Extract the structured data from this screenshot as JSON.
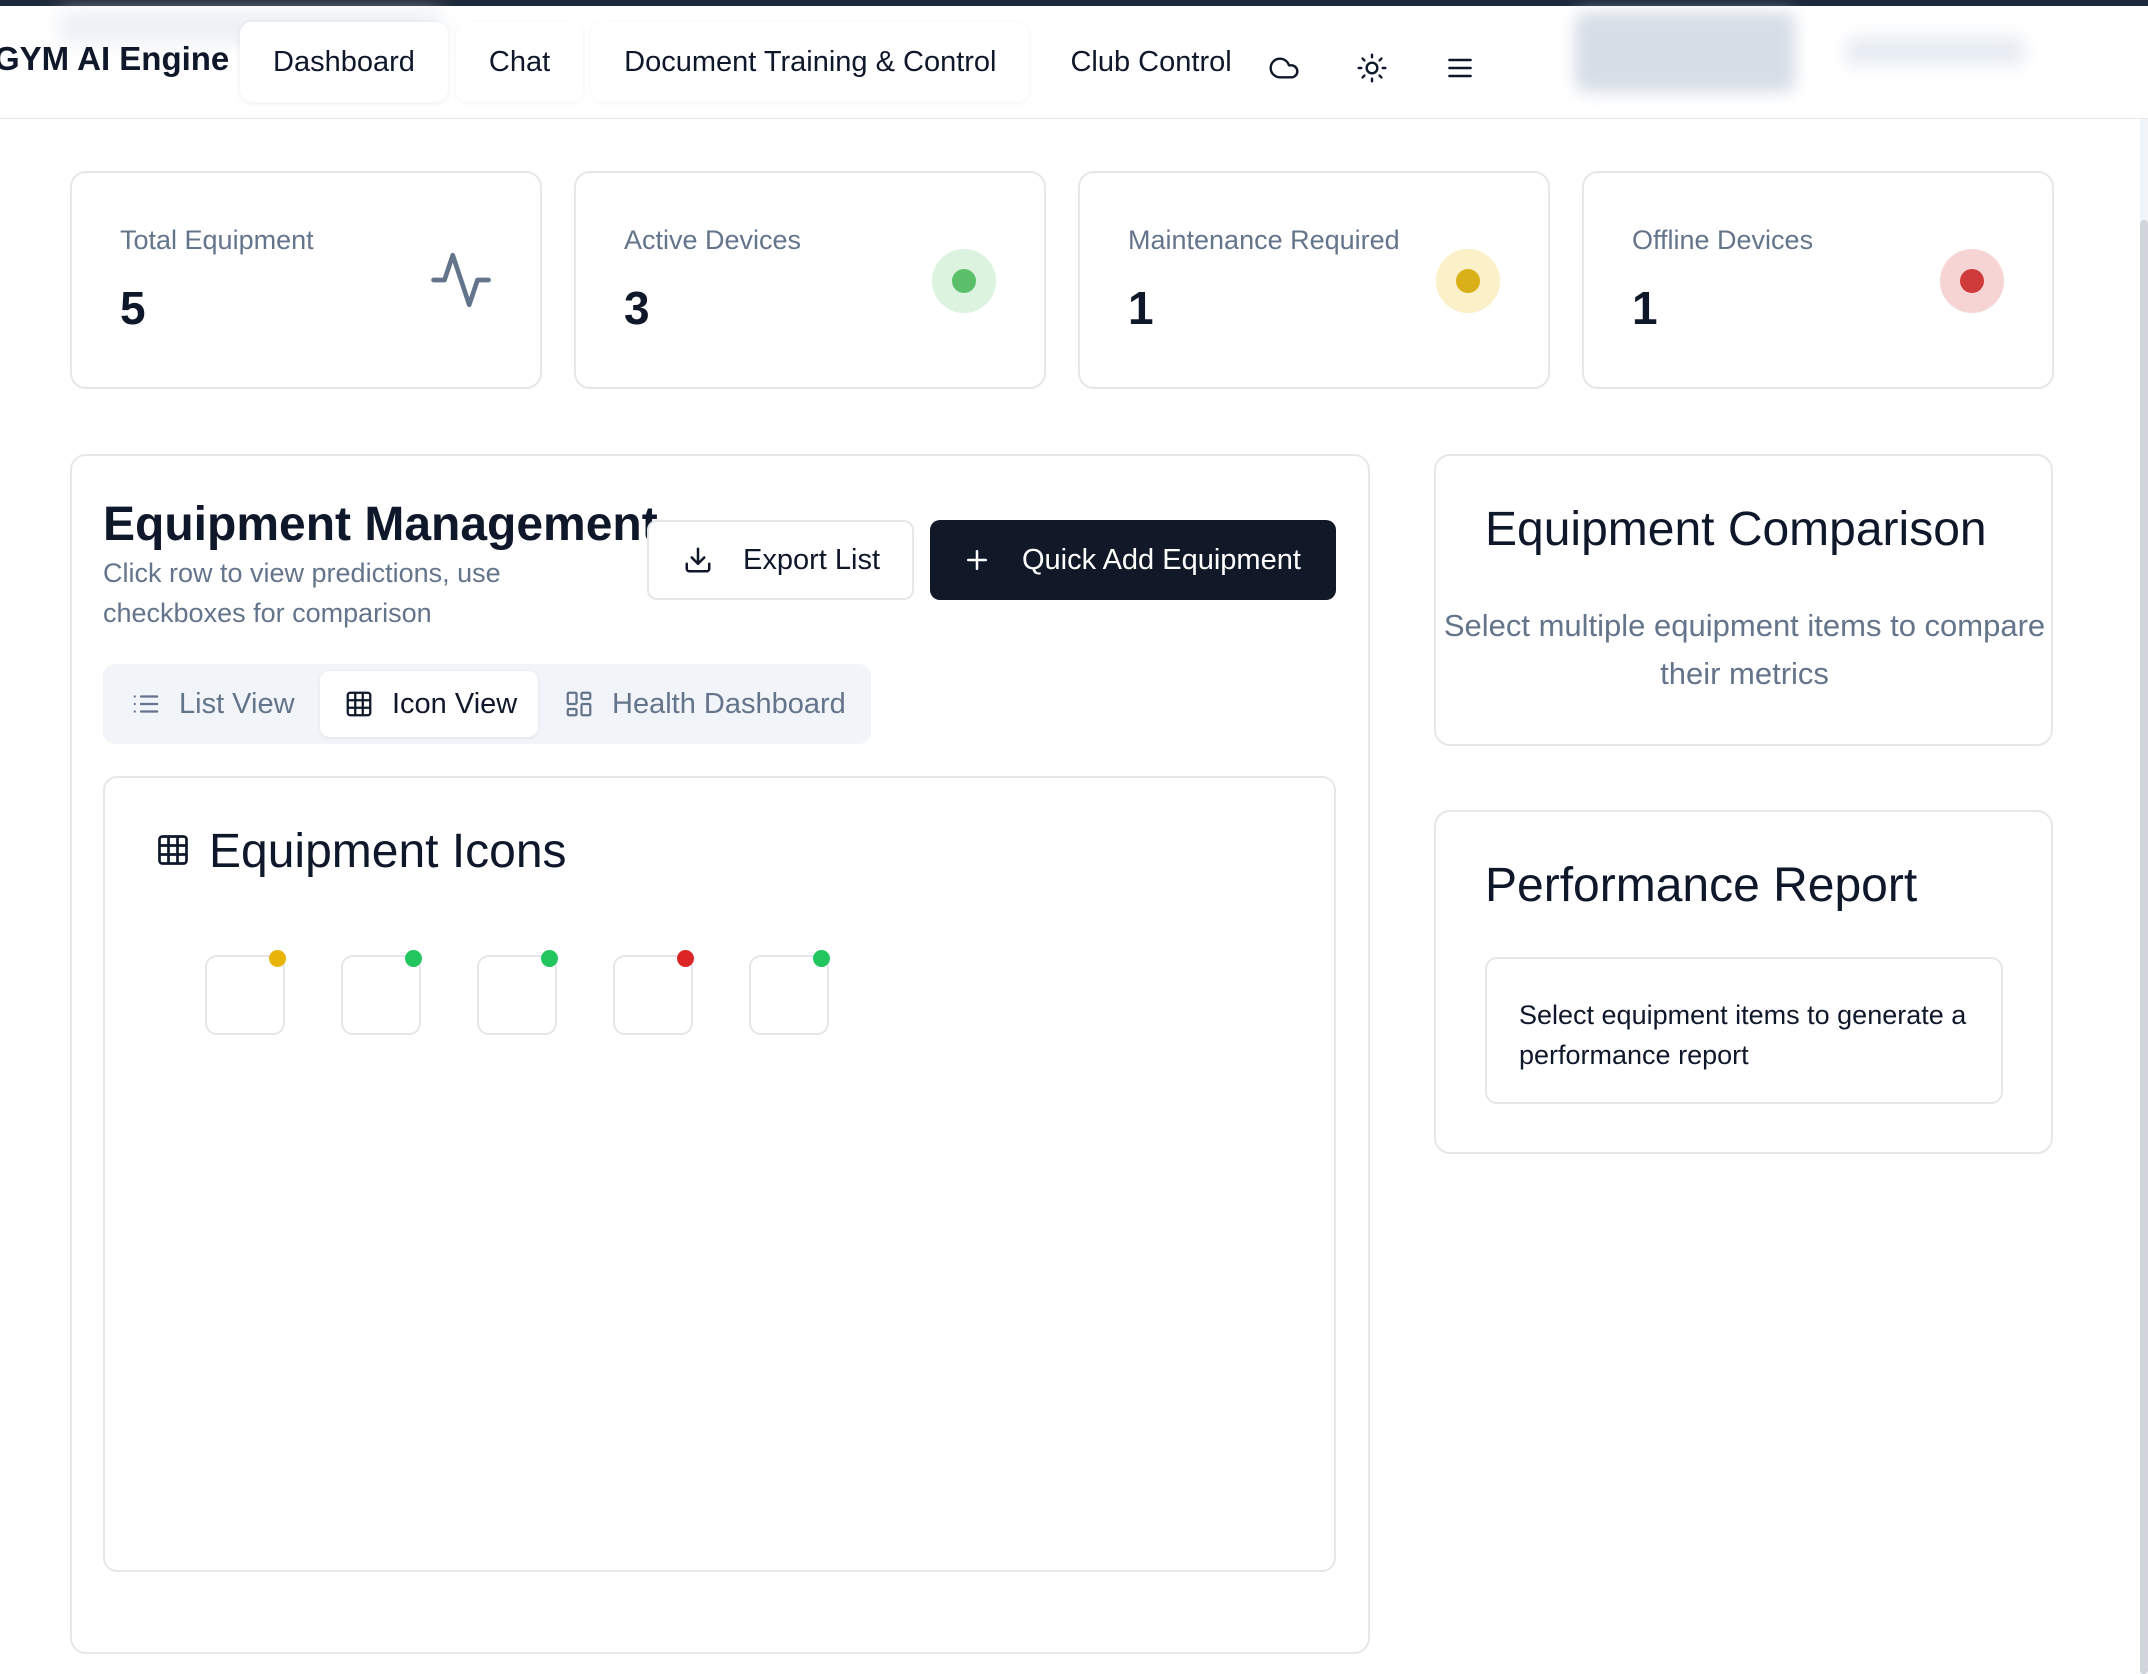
{
  "app": {
    "brand": "GYM AI Engine"
  },
  "nav": {
    "items": [
      {
        "label": "Dashboard",
        "active": true
      },
      {
        "label": "Chat"
      },
      {
        "label": "Document Training & Control"
      },
      {
        "label": "Club Control"
      }
    ],
    "icons": [
      "cloud-icon",
      "sun-icon",
      "menu-icon"
    ]
  },
  "stats": [
    {
      "label": "Total Equipment",
      "value": "5",
      "icon": "activity-icon"
    },
    {
      "label": "Active Devices",
      "value": "3",
      "status_color": "#22c55e"
    },
    {
      "label": "Maintenance Required",
      "value": "1",
      "status_color": "#eab308"
    },
    {
      "label": "Offline Devices",
      "value": "1",
      "status_color": "#dc2626"
    }
  ],
  "management": {
    "title": "Equipment Management",
    "subtitle": "Click row to view predictions, use checkboxes for comparison",
    "export_label": "Export List",
    "quick_add_label": "Quick Add Equipment",
    "tabs": [
      {
        "label": "List View",
        "icon": "list-icon"
      },
      {
        "label": "Icon View",
        "icon": "grid-icon",
        "active": true
      },
      {
        "label": "Health Dashboard",
        "icon": "dashboard-icon"
      }
    ],
    "icons_panel": {
      "title": "Equipment Icons",
      "tiles": [
        {
          "status": "maintenance",
          "color": "#eab308"
        },
        {
          "status": "active",
          "color": "#22c55e"
        },
        {
          "status": "active",
          "color": "#22c55e"
        },
        {
          "status": "offline",
          "color": "#dc2626"
        },
        {
          "status": "active",
          "color": "#22c55e"
        }
      ]
    }
  },
  "comparison": {
    "title": "Equipment Comparison",
    "text": "Select multiple equipment items to compare their metrics"
  },
  "performance": {
    "title": "Performance Report",
    "text": "Select equipment items to generate a performance report"
  }
}
